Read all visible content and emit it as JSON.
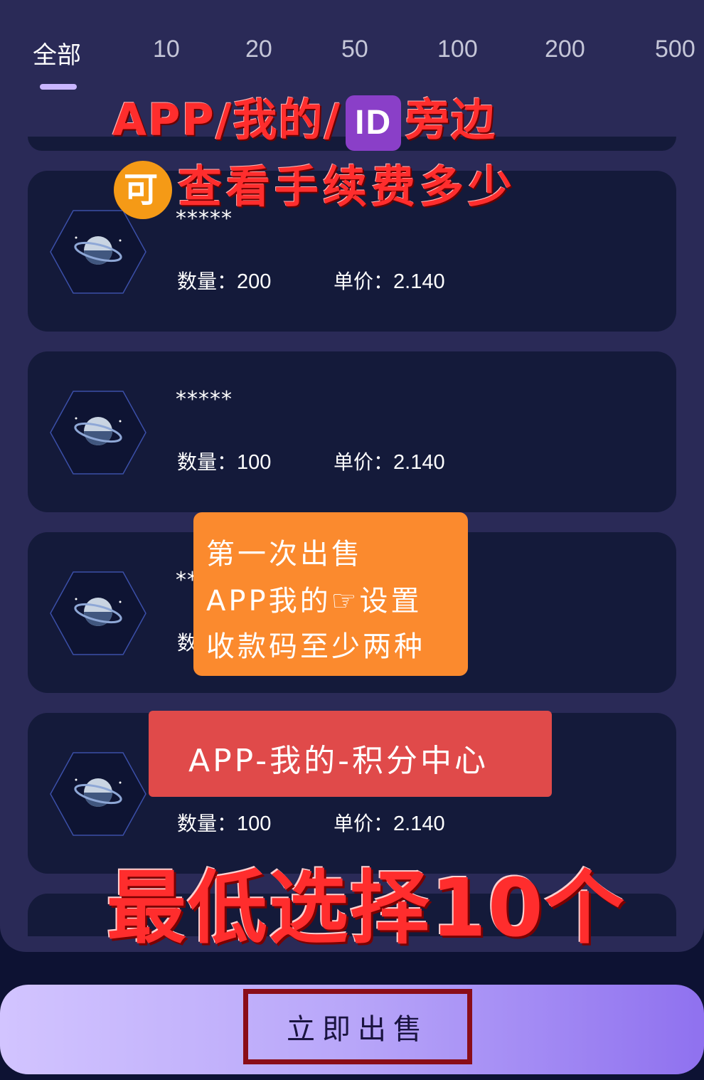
{
  "tabs": [
    "全部",
    "10",
    "20",
    "50",
    "100",
    "200",
    "500"
  ],
  "active_tab": "全部",
  "listings": [
    {
      "name": "*****",
      "qty_label": "数量：",
      "qty": "200",
      "price_label": "单价：",
      "price": "2.140"
    },
    {
      "name": "*****",
      "qty_label": "数量：",
      "qty": "100",
      "price_label": "单价：",
      "price": "2.140"
    },
    {
      "name": "**",
      "qty_label": "数",
      "qty": "",
      "price_label": "",
      "price": ""
    },
    {
      "name": "*",
      "qty_label": "数量：",
      "qty": "100",
      "price_label": "单价：",
      "price": "2.140"
    }
  ],
  "annotations": {
    "line1_prefix": "APP/我的/",
    "id_badge": "ID",
    "line1_suffix": "旁边",
    "ke_badge": "可",
    "line2": "查看手续费多少",
    "orange": [
      "第一次出售",
      "APP我的☞设置",
      "收款码至少两种"
    ],
    "red_box": "APP-我的-积分中心",
    "bottom": "最低选择10个"
  },
  "sell_button": "立即出售",
  "colors": {
    "background": "#0d1233",
    "panel": "#2a2a57",
    "card": "#141a3a",
    "tab_indicator": "#c9b6ff",
    "annotation_red": "#ff2d2d",
    "orange_box": "#fb8a2e",
    "red_box": "#e04a4a",
    "button_border": "#8a0d18"
  },
  "icons": [
    "planet-icon"
  ]
}
